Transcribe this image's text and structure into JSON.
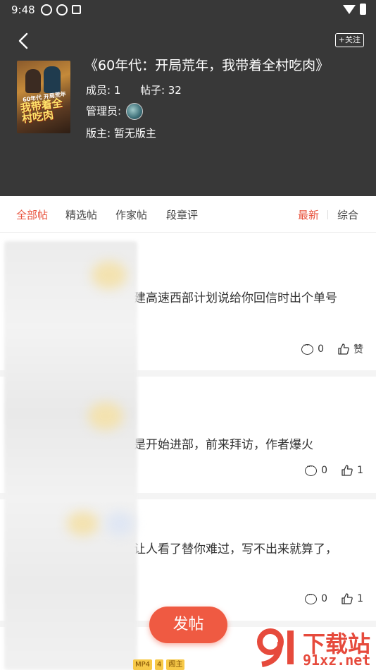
{
  "status_bar": {
    "time": "9:48"
  },
  "header": {
    "follow_label": "+关注",
    "group_title": "《60年代：开局荒年，我带着全村吃肉》",
    "members_label": "成员: 1",
    "posts_label": "帖子: 32",
    "admin_label": "管理员:",
    "moderator_label": "版主: 暂无版主",
    "cover": {
      "tag": "60年代 开局荒年",
      "title": "我带着全村吃肉",
      "subtitle": "我带着全村吃肉"
    }
  },
  "tabs": [
    {
      "label": "全部帖",
      "active": true
    },
    {
      "label": "精选帖",
      "active": false
    },
    {
      "label": "作家帖",
      "active": false
    },
    {
      "label": "段章评",
      "active": false
    }
  ],
  "sort": [
    {
      "label": "最新",
      "active": true
    },
    {
      "label": "综合",
      "active": false
    }
  ],
  "posts": [
    {
      "text": "建高速西部计划说给你回信时出个单号",
      "comments": "0",
      "likes": "赞"
    },
    {
      "text": "是开始进部，前来拜访，作者爆火",
      "comments": "0",
      "likes": "1"
    },
    {
      "text": "让人看了替你难过，写不出来就算了，",
      "comments": "0",
      "likes": "1"
    }
  ],
  "badges": [
    "MP4",
    "4",
    "阁主"
  ],
  "fab_label": "发帖",
  "watermark": {
    "title": "下载站",
    "domain": "91xz.net"
  },
  "colors": {
    "accent": "#e8533d",
    "header_bg": "#383838",
    "fab": "#ef5a42"
  },
  "icons": [
    "back-arrow-icon",
    "comment-icon",
    "like-icon",
    "wifi-icon",
    "battery-icon"
  ]
}
